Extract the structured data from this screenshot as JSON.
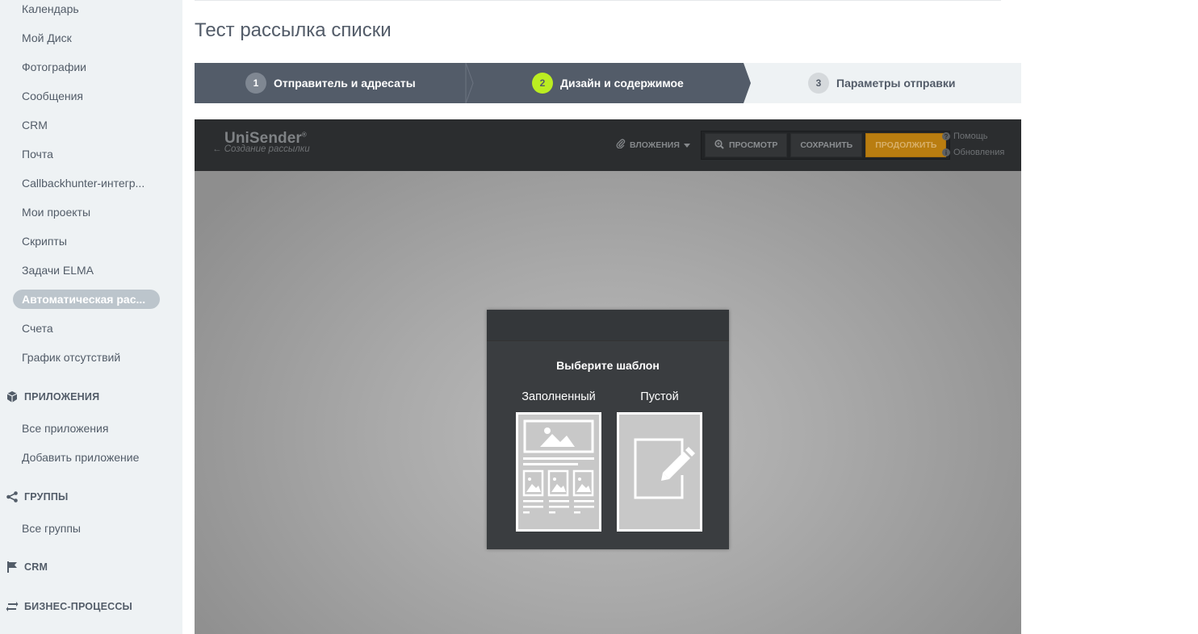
{
  "sidebar": {
    "items": [
      {
        "label": "Календарь"
      },
      {
        "label": "Мой Диск"
      },
      {
        "label": "Фотографии"
      },
      {
        "label": "Сообщения"
      },
      {
        "label": "CRM"
      },
      {
        "label": "Почта"
      },
      {
        "label": "Callbackhunter-интегр..."
      },
      {
        "label": "Мои проекты"
      },
      {
        "label": "Скрипты"
      },
      {
        "label": "Задачи ELMA"
      },
      {
        "label": "Автоматическая рас..."
      },
      {
        "label": "Счета"
      },
      {
        "label": "График отсутствий"
      }
    ],
    "active_index": 10,
    "apps_section": {
      "title": "ПРИЛОЖЕНИЯ",
      "icon": "box-icon",
      "items": [
        {
          "label": "Все приложения"
        },
        {
          "label": "Добавить приложение"
        }
      ]
    },
    "groups_section": {
      "title": "ГРУППЫ",
      "icon": "share-icon",
      "items": [
        {
          "label": "Все группы"
        }
      ]
    },
    "crm_section": {
      "title": "CRM",
      "icon": "flag-icon"
    },
    "bp_section": {
      "title": "БИЗНЕС-ПРОЦЕССЫ",
      "icon": "process-icon"
    }
  },
  "page": {
    "title": "Тест рассылка списки"
  },
  "steps": [
    {
      "num": "1",
      "label": "Отправитель и адресаты",
      "state": "done"
    },
    {
      "num": "2",
      "label": "Дизайн и содержимое",
      "state": "current"
    },
    {
      "num": "3",
      "label": "Параметры отправки",
      "state": "upcoming"
    }
  ],
  "editor": {
    "logo": "UniSender",
    "logo_mark": "®",
    "back_link": "Создание рассылки",
    "attachments_label": "ВЛОЖЕНИЯ",
    "preview_label": "ПРОСМОТР",
    "save_label": "СОХРАНИТЬ",
    "continue_label": "ПРОДОЛЖИТЬ",
    "help_label": "Помощь",
    "updates_label": "Обновления"
  },
  "dialog": {
    "title": "Выберите шаблон",
    "filled_label": "Заполненный",
    "empty_label": "Пустой"
  },
  "colors": {
    "sidebar_bg": "#eef2f4",
    "step_done_bg": "#535c69",
    "step_current_badge": "#bbed21",
    "editor_bar": "#2b2d2f",
    "continue_button": "#b97d10"
  }
}
